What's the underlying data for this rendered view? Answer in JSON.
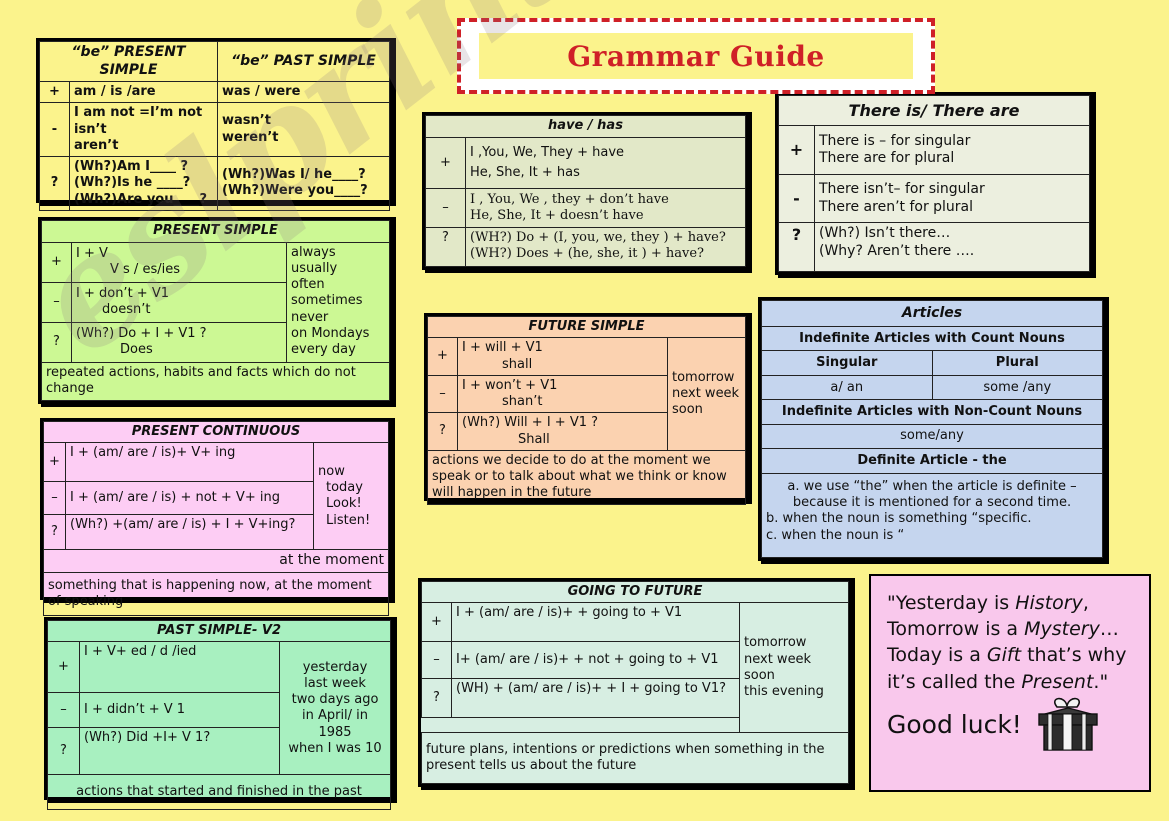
{
  "banner": {
    "title": "Grammar Guide",
    "accent": "#cf2027"
  },
  "watermark": {
    "text": "eslprintables.com"
  },
  "page": {
    "background": "#fbf38c"
  },
  "be_table": {
    "color": "#fbf38c",
    "headers": [
      "“be” PRESENT SIMPLE",
      "“be” PAST SIMPLE"
    ],
    "rows": [
      {
        "sign": "+",
        "present": [
          "am / is /are"
        ],
        "past": [
          "was / were"
        ]
      },
      {
        "sign": "-",
        "present": [
          "I am not =I’m not",
          "isn’t",
          "aren’t"
        ],
        "past": [
          "wasn’t",
          "weren’t"
        ]
      },
      {
        "sign": "?",
        "present": [
          "(Wh?)Am I____ ?",
          "(Wh?)Is he ____?",
          "(Wh?)Are you____?"
        ],
        "past": [
          "(Wh?)Was I/ he____?",
          "(Wh?)Were you____?"
        ]
      }
    ]
  },
  "present_simple": {
    "color": "#ccf894",
    "title": "PRESENT SIMPLE",
    "rows": [
      {
        "sign": "+",
        "line1": "I +  V",
        "line2": "V  s / es/ies"
      },
      {
        "sign": "–",
        "line1": "I +  don’t  +  V1",
        "line2": "doesn’t"
      },
      {
        "sign": "?",
        "line1": "(Wh?)  Do   + I + V1 ?",
        "line2": "Does"
      }
    ],
    "adverbs": [
      "always",
      "usually",
      "often",
      "sometimes",
      "never",
      "on Mondays",
      "every day"
    ],
    "footer": "repeated actions, habits and facts      which do not change"
  },
  "present_continuous": {
    "color": "#fdcdf4",
    "title": "PRESENT CONTINUOUS",
    "rows": [
      {
        "sign": "+",
        "text": "I + (am/  are / is)+ V+ ing"
      },
      {
        "sign": "–",
        "text": "I + (am/  are / is) + not + V+ ing"
      },
      {
        "sign": "?",
        "text": "(Wh?) +(am/  are / is) + I + V+ing?"
      }
    ],
    "adverbs": [
      "now",
      "today",
      "Look!",
      "Listen!"
    ],
    "adverb_extra": "at the moment",
    "footer": "something that is happening now, at the moment of speaking"
  },
  "past_simple": {
    "color": "#a8f0c0",
    "title": "PAST SIMPLE-  V2",
    "rows": [
      {
        "sign": "+",
        "text": "I + V+ ed / d /ied"
      },
      {
        "sign": "–",
        "text": "I +  didn’t + V 1"
      },
      {
        "sign": "?",
        "text": "(Wh?) Did +I+ V 1?"
      }
    ],
    "adverbs": [
      "yesterday",
      "last week",
      "two days ago",
      "in April/ in 1985",
      "when I was 10"
    ],
    "footer": "actions that started and finished in the past"
  },
  "have_has": {
    "color": "#e2e8c8",
    "title": "have / has",
    "rows": [
      {
        "sign": "+",
        "lines": [
          "I ,You, We, They  + have",
          "He, She, It + has"
        ]
      },
      {
        "sign": "–",
        "lines": [
          "I , You, We , they  + don’t have",
          "He, She,  It + doesn’t have"
        ]
      },
      {
        "sign": "?",
        "lines": [
          "(WH?)  Do  + (I,  you, we, they ) + have?",
          "(WH?)  Does  + (he, she, it  ) + have?"
        ]
      }
    ]
  },
  "future_simple": {
    "color": "#fbd2b0",
    "title": "FUTURE SIMPLE",
    "rows": [
      {
        "sign": "+",
        "line1": "I  +  will   +  V1",
        "line2": "shall"
      },
      {
        "sign": "–",
        "line1": "I  +  won’t   +  V1",
        "line2": "shan’t"
      },
      {
        "sign": "?",
        "line1": "(Wh?) Will + I + V1 ?",
        "line2": "Shall"
      }
    ],
    "adverbs": [
      "tomorrow",
      "next week",
      "soon"
    ],
    "footer": "actions we decide to do at the moment we speak or to talk about what we think or know will happen in the  future"
  },
  "going_to": {
    "color": "#d7eee2",
    "title": "GOING TO FUTURE",
    "rows": [
      {
        "sign": "+",
        "text": "I +  (am/  are / is)+ + going to + V1"
      },
      {
        "sign": "–",
        "text": "I+  (am/  are / is)+ + not + going to + V1"
      },
      {
        "sign": "?",
        "text": "(WH) + (am/  are / is)+ + I + going to V1?"
      }
    ],
    "adverbs": [
      "tomorrow",
      "next week",
      "soon",
      "this evening"
    ],
    "footer": "future plans, intentions or predictions when something in the present tells us about the future"
  },
  "there_is": {
    "color": "#ecefdf",
    "title": "There is/ There are",
    "rows": [
      {
        "sign": "+",
        "lines": [
          "There is – for singular",
          "There are for plural"
        ]
      },
      {
        "sign": "-",
        "lines": [
          "There isn’t– for singular",
          "There aren’t  for plural"
        ]
      },
      {
        "sign": "?",
        "lines": [
          "(Wh?) Isn’t  there…",
          "(Why?  Aren’t there …."
        ]
      }
    ]
  },
  "articles": {
    "color": "#c5d5ee",
    "title": "Articles",
    "count_heading": "Indefinite Articles with Count Nouns",
    "count_columns": [
      "Singular",
      "Plural"
    ],
    "count_values": [
      "a/ an",
      "some /any"
    ],
    "noncount_heading": "Indefinite Articles with Non-Count Nouns",
    "noncount_value": "some/any",
    "definite_heading": "Definite Article - the",
    "rules": [
      "a. we use “the” when the article is definite –",
      "because it is mentioned for a second time.",
      "b. when the noun is something “specific.",
      "c.  when the noun is “"
    ]
  },
  "quote": {
    "color": "#f9c8ec",
    "lines": [
      {
        "pre": "\"Yesterday is ",
        "em": "History",
        "post": ","
      },
      {
        "pre": "Tomorrow is a ",
        "em": "Mystery",
        "post": "…"
      },
      {
        "pre": "Today is a ",
        "em": "Gift",
        "post": " that’s why"
      },
      {
        "pre": "it’s called the ",
        "em": "Present",
        "post": ".\""
      }
    ],
    "good_luck": "Good luck!",
    "icon": "gift-box-icon"
  }
}
